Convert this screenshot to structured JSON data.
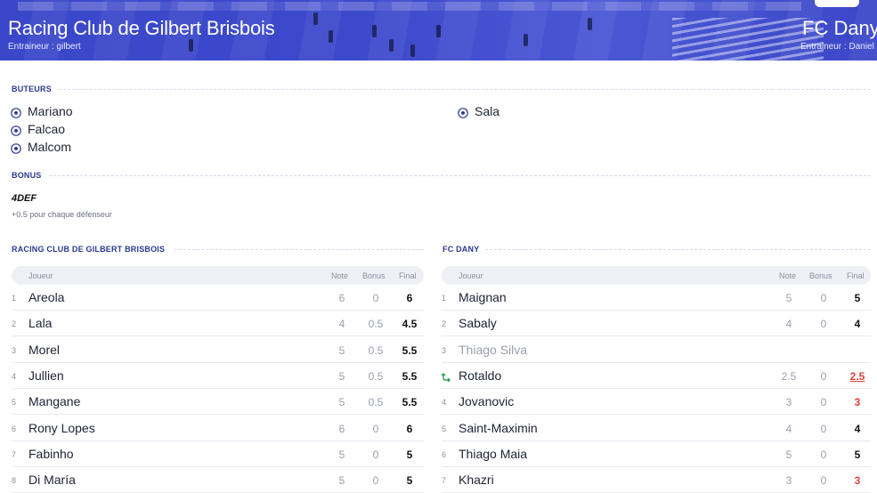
{
  "header": {
    "home_team": "Racing Club de Gilbert Brisbois",
    "home_coach": "Entraineur : gilbert",
    "away_team": "FC Dany",
    "away_coach": "Entraineur : Daniel"
  },
  "scorers": {
    "title": "BUTEURS",
    "home": [
      "Mariano",
      "Falcao",
      "Malcom"
    ],
    "away": [
      "Sala"
    ]
  },
  "bonus": {
    "title": "BONUS",
    "name": "4DEF",
    "description": "+0.5 pour chaque défenseur"
  },
  "home_table": {
    "title": "RACING CLUB DE GILBERT BRISBOIS",
    "headers": {
      "player": "Joueur",
      "note": "Note",
      "bonus": "Bonus",
      "final": "Final"
    },
    "rows": [
      {
        "num": "1",
        "name": "Areola",
        "note": "6",
        "bonus": "0",
        "final": "6"
      },
      {
        "num": "2",
        "name": "Lala",
        "note": "4",
        "bonus": "0.5",
        "final": "4.5"
      },
      {
        "num": "3",
        "name": "Morel",
        "note": "5",
        "bonus": "0.5",
        "final": "5.5"
      },
      {
        "num": "4",
        "name": "Jullien",
        "note": "5",
        "bonus": "0.5",
        "final": "5.5"
      },
      {
        "num": "5",
        "name": "Mangane",
        "note": "5",
        "bonus": "0.5",
        "final": "5.5"
      },
      {
        "num": "6",
        "name": "Rony Lopes",
        "note": "6",
        "bonus": "0",
        "final": "6"
      },
      {
        "num": "7",
        "name": "Fabinho",
        "note": "5",
        "bonus": "0",
        "final": "5"
      },
      {
        "num": "8",
        "name": "Di María",
        "note": "5",
        "bonus": "0",
        "final": "5"
      }
    ]
  },
  "away_table": {
    "title": "FC DANY",
    "headers": {
      "player": "Joueur",
      "note": "Note",
      "bonus": "Bonus",
      "final": "Final"
    },
    "rows": [
      {
        "num": "1",
        "name": "Maignan",
        "note": "5",
        "bonus": "0",
        "final": "5"
      },
      {
        "num": "2",
        "name": "Sabaly",
        "note": "4",
        "bonus": "0",
        "final": "4"
      },
      {
        "num": "3",
        "name": "Thiago Silva",
        "note": "",
        "bonus": "",
        "final": ""
      },
      {
        "num": "",
        "name": "Rotaldo",
        "note": "2.5",
        "bonus": "0",
        "final": "2.5"
      },
      {
        "num": "4",
        "name": "Jovanovic",
        "note": "3",
        "bonus": "0",
        "final": "3"
      },
      {
        "num": "5",
        "name": "Saint-Maximin",
        "note": "4",
        "bonus": "0",
        "final": "4"
      },
      {
        "num": "6",
        "name": "Thiago Maia",
        "note": "5",
        "bonus": "0",
        "final": "5"
      },
      {
        "num": "7",
        "name": "Khazri",
        "note": "3",
        "bonus": "0",
        "final": "3"
      }
    ]
  },
  "colors": {
    "header_blue": "#3d49cc",
    "section_title": "#2b3a8f",
    "final_red": "#e0443a",
    "sub_green": "#2e9e4f"
  }
}
